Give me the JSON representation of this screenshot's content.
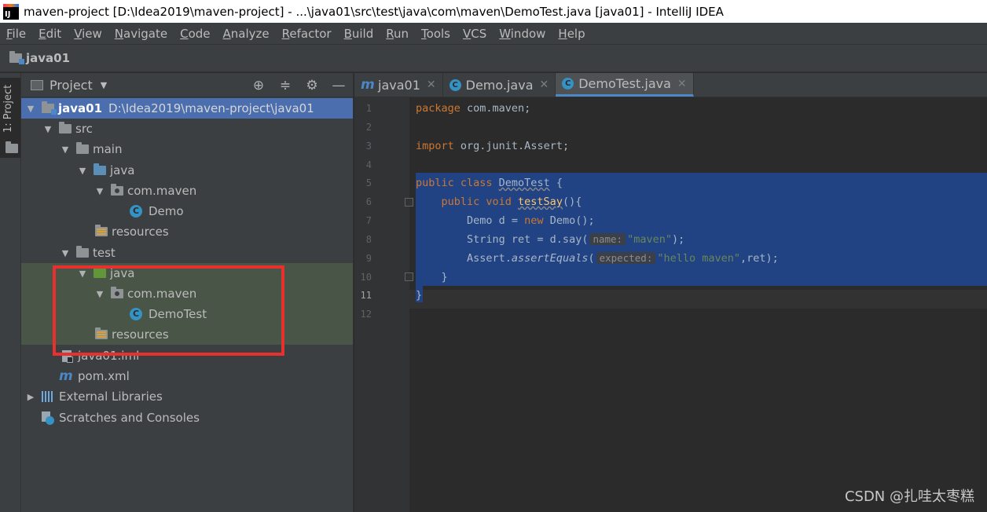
{
  "window": {
    "title": "maven-project [D:\\Idea2019\\maven-project] - ...\\java01\\src\\test\\java\\com\\maven\\DemoTest.java [java01] - IntelliJ IDEA",
    "logo_text": "IJ"
  },
  "menubar": {
    "items": [
      "File",
      "Edit",
      "View",
      "Navigate",
      "Code",
      "Analyze",
      "Refactor",
      "Build",
      "Run",
      "Tools",
      "VCS",
      "Window",
      "Help"
    ]
  },
  "navbar": {
    "breadcrumb": "java01"
  },
  "toolstrip": {
    "tab_label": "1: Project"
  },
  "project_panel": {
    "title": "Project",
    "tree": [
      {
        "label": "java01",
        "path": "D:\\Idea2019\\maven-project\\java01"
      },
      {
        "label": "src"
      },
      {
        "label": "main"
      },
      {
        "label": "java"
      },
      {
        "label": "com.maven"
      },
      {
        "label": "Demo"
      },
      {
        "label": "resources"
      },
      {
        "label": "test"
      },
      {
        "label": "java"
      },
      {
        "label": "com.maven"
      },
      {
        "label": "DemoTest"
      },
      {
        "label": "resources"
      },
      {
        "label": "java01.iml"
      },
      {
        "label": "pom.xml"
      },
      {
        "label": "External Libraries"
      },
      {
        "label": "Scratches and Consoles"
      }
    ]
  },
  "editor": {
    "tabs": [
      {
        "label": "java01"
      },
      {
        "label": "Demo.java"
      },
      {
        "label": "DemoTest.java"
      }
    ],
    "line_numbers": [
      "1",
      "2",
      "3",
      "4",
      "5",
      "6",
      "7",
      "8",
      "9",
      "10",
      "11",
      "12"
    ],
    "code": {
      "l1_kw": "package",
      "l1_rest": " com.maven;",
      "l3_kw": "import",
      "l3_rest": " org.junit.Assert;",
      "l5_kw": "public class ",
      "l5_name": "DemoTest",
      "l5_rest": " {",
      "l6_kw": "    public void ",
      "l6_name": "testSay",
      "l6_rest": "(){",
      "l7_a": "        Demo d = ",
      "l7_kw": "new",
      "l7_b": " Demo();",
      "l8_a": "        String ret = d.say(",
      "l8_hint": "name:",
      "l8_str": "\"maven\"",
      "l8_b": ");",
      "l9_a": "        Assert.",
      "l9_method": "assertEquals",
      "l9_b": "(",
      "l9_hint": "expected:",
      "l9_str": "\"hello maven\"",
      "l9_c": ",ret);",
      "l10": "    }",
      "l11": "}"
    }
  },
  "watermark": "CSDN @扎哇太枣糕",
  "colors": {
    "selection": "#214283",
    "highlight_border": "#e8312f",
    "tree_selected": "#4b6eaf",
    "test_area": "#495546"
  }
}
